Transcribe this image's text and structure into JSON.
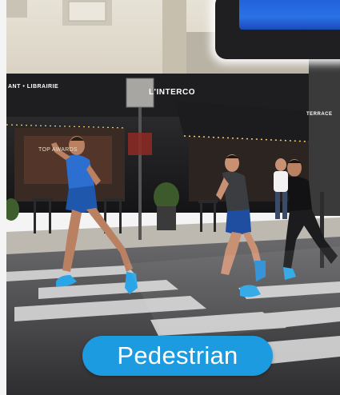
{
  "label": {
    "text": "Pedestrian",
    "color": "#1c9be0"
  },
  "storefront": {
    "left_sign": "ANT • LIBRAIRIE",
    "center_sign": "L'INTERCO",
    "right_sign": "TERRACE",
    "poster": "TOP   AWARDS"
  },
  "colors": {
    "shirt_blue": "#2c6fd1",
    "shoe_cyan": "#2aa6e6",
    "awning": "#1c1c1e",
    "road": "#3d3d40",
    "crosswalk": "#d8d8d8"
  },
  "scene": {
    "subjects": [
      "runner-blue-shirt",
      "runner-grey-shirt",
      "runner-black-shirt"
    ],
    "setting": "city-street-crosswalk"
  }
}
